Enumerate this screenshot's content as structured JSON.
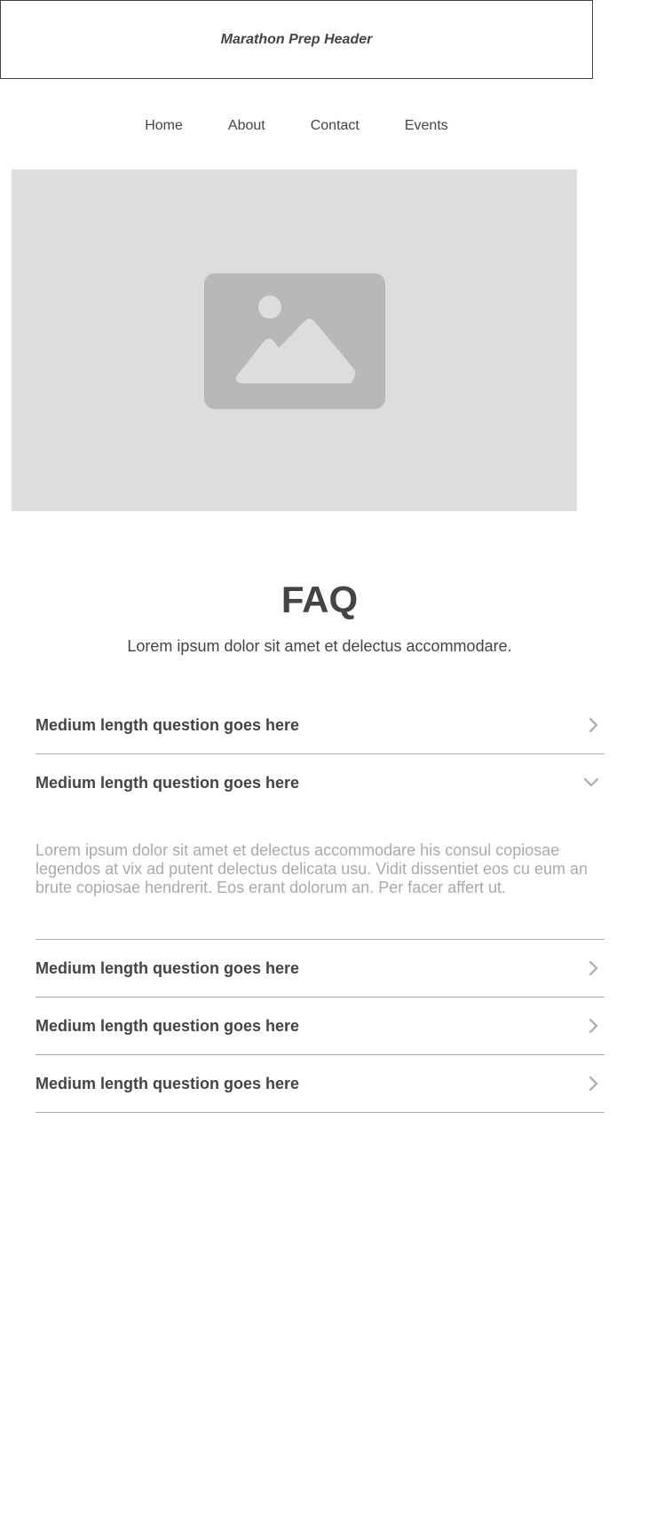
{
  "header": {
    "title": "Marathon Prep Header"
  },
  "nav": {
    "items": [
      {
        "label": "Home"
      },
      {
        "label": "About"
      },
      {
        "label": "Contact"
      },
      {
        "label": "Events"
      }
    ]
  },
  "hero": {
    "icon": "image-placeholder-icon",
    "background_color": "#dddddd",
    "icon_color": "#b8b8b8"
  },
  "faq": {
    "title": "FAQ",
    "subtitle": "Lorem ipsum dolor sit amet et delectus accommodare.",
    "items": [
      {
        "question": "Medium length question goes here",
        "expanded": false
      },
      {
        "question": "Medium length question goes here",
        "expanded": true,
        "answer": "Lorem ipsum dolor sit amet et delectus accommodare his consul copiosae legendos at vix ad putent delectus delicata usu. Vidit dissentiet eos cu eum an brute copiosae hendrerit. Eos erant dolorum an. Per facer affert ut."
      },
      {
        "question": "Medium length question goes here",
        "expanded": false
      },
      {
        "question": "Medium length question goes here",
        "expanded": false
      },
      {
        "question": "Medium length question goes here",
        "expanded": false
      }
    ]
  },
  "colors": {
    "text": "#444444",
    "muted": "#aaaaaa",
    "divider": "#aaaaaa"
  }
}
